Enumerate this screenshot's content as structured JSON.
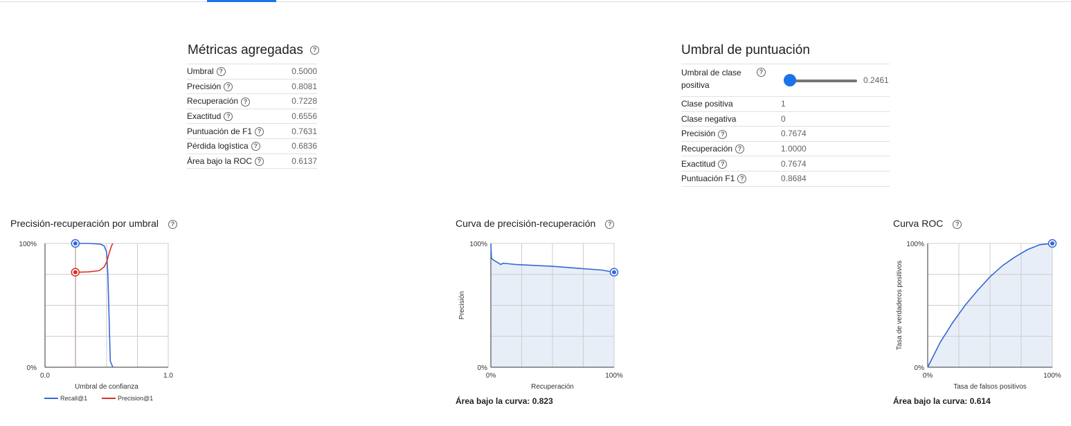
{
  "aggregated": {
    "title": "Métricas agregadas",
    "rows": [
      {
        "label": "Umbral",
        "value": "0.5000"
      },
      {
        "label": "Precisión",
        "value": "0.8081"
      },
      {
        "label": "Recuperación",
        "value": "0.7228"
      },
      {
        "label": "Exactitud",
        "value": "0.6556"
      },
      {
        "label": "Puntuación de F1",
        "value": "0.7631"
      },
      {
        "label": "Pérdida logística",
        "value": "0.6836"
      },
      {
        "label": "Área bajo la ROC",
        "value": "0.6137"
      }
    ]
  },
  "threshold": {
    "title": "Umbral de puntuación",
    "slider_label_line1": "Umbral de clase",
    "slider_label_line2": "positiva",
    "slider_value": "0.2461",
    "slider_fraction": 0.2461,
    "rows": [
      {
        "label": "Clase positiva",
        "value": "1",
        "help": false
      },
      {
        "label": "Clase negativa",
        "value": "0",
        "help": false
      },
      {
        "label": "Precisión",
        "value": "0.7674",
        "help": true
      },
      {
        "label": "Recuperación",
        "value": "1.0000",
        "help": true
      },
      {
        "label": "Exactitud",
        "value": "0.7674",
        "help": true
      },
      {
        "label": "Puntuación F1",
        "value": "0.8684",
        "help": true
      }
    ]
  },
  "charts": {
    "pr_threshold": {
      "title": "Precisión-recuperación por umbral",
      "xlabel": "Umbral de confianza",
      "x_ticks": [
        "0.0",
        "1.0"
      ],
      "y_ticks": [
        "0%",
        "100%"
      ],
      "legend": [
        "Recall@1",
        "Precision@1"
      ]
    },
    "pr_curve": {
      "title": "Curva de precisión-recuperación",
      "xlabel": "Recuperación",
      "ylabel": "Precisión",
      "x_ticks": [
        "0%",
        "100%"
      ],
      "y_ticks": [
        "0%",
        "100%"
      ],
      "auc": "Área bajo la curva: 0.823"
    },
    "roc": {
      "title": "Curva ROC",
      "xlabel": "Tasa de falsos positivos",
      "ylabel": "Tasa de verdaderos positivos",
      "x_ticks": [
        "0%",
        "100%"
      ],
      "y_ticks": [
        "0%",
        "100%"
      ],
      "auc": "Área bajo la curva: 0.614"
    }
  },
  "colors": {
    "recall": "#3367d6",
    "precision": "#d93025",
    "accent": "#1a73e8",
    "fill": "#e8eef8"
  },
  "chart_data": [
    {
      "type": "line",
      "title": "Precisión-recuperación por umbral",
      "xlabel": "Umbral de confianza",
      "xlim": [
        0,
        1
      ],
      "ylim": [
        0,
        1
      ],
      "series": [
        {
          "name": "Recall@1",
          "x": [
            0.25,
            0.35,
            0.45,
            0.48,
            0.5,
            0.51,
            0.52,
            0.53,
            0.55
          ],
          "y": [
            1.0,
            1.0,
            0.995,
            0.98,
            0.93,
            0.75,
            0.4,
            0.05,
            0.0
          ]
        },
        {
          "name": "Precision@1",
          "x": [
            0.25,
            0.35,
            0.44,
            0.48,
            0.5,
            0.52,
            0.54,
            0.55
          ],
          "y": [
            0.767,
            0.77,
            0.78,
            0.81,
            0.85,
            0.92,
            0.98,
            1.0
          ]
        }
      ],
      "markers": [
        {
          "series": "Recall@1",
          "x": 0.2461,
          "y": 1.0
        },
        {
          "series": "Precision@1",
          "x": 0.2461,
          "y": 0.7674
        }
      ]
    },
    {
      "type": "area",
      "title": "Curva de precisión-recuperación",
      "xlabel": "Recuperación",
      "ylabel": "Precisión",
      "xlim": [
        0,
        1
      ],
      "ylim": [
        0,
        1
      ],
      "x": [
        0.0,
        0.005,
        0.03,
        0.05,
        0.08,
        0.1,
        0.15,
        0.2,
        0.3,
        0.5,
        0.7,
        0.9,
        1.0
      ],
      "y": [
        1.0,
        0.88,
        0.86,
        0.85,
        0.83,
        0.84,
        0.835,
        0.83,
        0.825,
        0.815,
        0.8,
        0.785,
        0.767
      ],
      "marker": {
        "x": 1.0,
        "y": 0.7674
      },
      "auc": 0.823
    },
    {
      "type": "area",
      "title": "Curva ROC",
      "xlabel": "Tasa de falsos positivos",
      "ylabel": "Tasa de verdaderos positivos",
      "xlim": [
        0,
        1
      ],
      "ylim": [
        0,
        1
      ],
      "x": [
        0.0,
        0.05,
        0.1,
        0.15,
        0.2,
        0.3,
        0.4,
        0.5,
        0.6,
        0.7,
        0.8,
        0.9,
        1.0
      ],
      "y": [
        0.0,
        0.1,
        0.2,
        0.28,
        0.36,
        0.5,
        0.62,
        0.73,
        0.82,
        0.89,
        0.95,
        0.99,
        1.0
      ],
      "marker": {
        "x": 1.0,
        "y": 1.0
      },
      "auc": 0.614
    }
  ]
}
